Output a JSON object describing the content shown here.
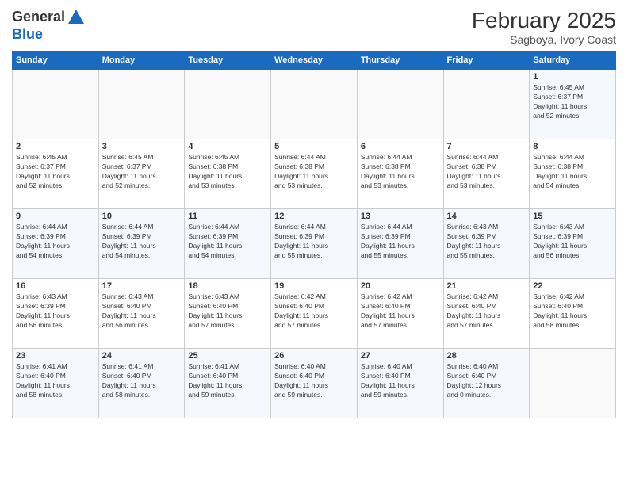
{
  "logo": {
    "general": "General",
    "blue": "Blue"
  },
  "header": {
    "month": "February 2025",
    "location": "Sagboya, Ivory Coast"
  },
  "days_of_week": [
    "Sunday",
    "Monday",
    "Tuesday",
    "Wednesday",
    "Thursday",
    "Friday",
    "Saturday"
  ],
  "weeks": [
    {
      "days": [
        {
          "num": "",
          "info": ""
        },
        {
          "num": "",
          "info": ""
        },
        {
          "num": "",
          "info": ""
        },
        {
          "num": "",
          "info": ""
        },
        {
          "num": "",
          "info": ""
        },
        {
          "num": "",
          "info": ""
        },
        {
          "num": "1",
          "info": "Sunrise: 6:45 AM\nSunset: 6:37 PM\nDaylight: 11 hours\nand 52 minutes."
        }
      ]
    },
    {
      "days": [
        {
          "num": "2",
          "info": "Sunrise: 6:45 AM\nSunset: 6:37 PM\nDaylight: 11 hours\nand 52 minutes."
        },
        {
          "num": "3",
          "info": "Sunrise: 6:45 AM\nSunset: 6:37 PM\nDaylight: 11 hours\nand 52 minutes."
        },
        {
          "num": "4",
          "info": "Sunrise: 6:45 AM\nSunset: 6:38 PM\nDaylight: 11 hours\nand 53 minutes."
        },
        {
          "num": "5",
          "info": "Sunrise: 6:44 AM\nSunset: 6:38 PM\nDaylight: 11 hours\nand 53 minutes."
        },
        {
          "num": "6",
          "info": "Sunrise: 6:44 AM\nSunset: 6:38 PM\nDaylight: 11 hours\nand 53 minutes."
        },
        {
          "num": "7",
          "info": "Sunrise: 6:44 AM\nSunset: 6:38 PM\nDaylight: 11 hours\nand 53 minutes."
        },
        {
          "num": "8",
          "info": "Sunrise: 6:44 AM\nSunset: 6:38 PM\nDaylight: 11 hours\nand 54 minutes."
        }
      ]
    },
    {
      "days": [
        {
          "num": "9",
          "info": "Sunrise: 6:44 AM\nSunset: 6:39 PM\nDaylight: 11 hours\nand 54 minutes."
        },
        {
          "num": "10",
          "info": "Sunrise: 6:44 AM\nSunset: 6:39 PM\nDaylight: 11 hours\nand 54 minutes."
        },
        {
          "num": "11",
          "info": "Sunrise: 6:44 AM\nSunset: 6:39 PM\nDaylight: 11 hours\nand 54 minutes."
        },
        {
          "num": "12",
          "info": "Sunrise: 6:44 AM\nSunset: 6:39 PM\nDaylight: 11 hours\nand 55 minutes."
        },
        {
          "num": "13",
          "info": "Sunrise: 6:44 AM\nSunset: 6:39 PM\nDaylight: 11 hours\nand 55 minutes."
        },
        {
          "num": "14",
          "info": "Sunrise: 6:43 AM\nSunset: 6:39 PM\nDaylight: 11 hours\nand 55 minutes."
        },
        {
          "num": "15",
          "info": "Sunrise: 6:43 AM\nSunset: 6:39 PM\nDaylight: 11 hours\nand 56 minutes."
        }
      ]
    },
    {
      "days": [
        {
          "num": "16",
          "info": "Sunrise: 6:43 AM\nSunset: 6:39 PM\nDaylight: 11 hours\nand 56 minutes."
        },
        {
          "num": "17",
          "info": "Sunrise: 6:43 AM\nSunset: 6:40 PM\nDaylight: 11 hours\nand 56 minutes."
        },
        {
          "num": "18",
          "info": "Sunrise: 6:43 AM\nSunset: 6:40 PM\nDaylight: 11 hours\nand 57 minutes."
        },
        {
          "num": "19",
          "info": "Sunrise: 6:42 AM\nSunset: 6:40 PM\nDaylight: 11 hours\nand 57 minutes."
        },
        {
          "num": "20",
          "info": "Sunrise: 6:42 AM\nSunset: 6:40 PM\nDaylight: 11 hours\nand 57 minutes."
        },
        {
          "num": "21",
          "info": "Sunrise: 6:42 AM\nSunset: 6:40 PM\nDaylight: 11 hours\nand 57 minutes."
        },
        {
          "num": "22",
          "info": "Sunrise: 6:42 AM\nSunset: 6:40 PM\nDaylight: 11 hours\nand 58 minutes."
        }
      ]
    },
    {
      "days": [
        {
          "num": "23",
          "info": "Sunrise: 6:41 AM\nSunset: 6:40 PM\nDaylight: 11 hours\nand 58 minutes."
        },
        {
          "num": "24",
          "info": "Sunrise: 6:41 AM\nSunset: 6:40 PM\nDaylight: 11 hours\nand 58 minutes."
        },
        {
          "num": "25",
          "info": "Sunrise: 6:41 AM\nSunset: 6:40 PM\nDaylight: 11 hours\nand 59 minutes."
        },
        {
          "num": "26",
          "info": "Sunrise: 6:40 AM\nSunset: 6:40 PM\nDaylight: 11 hours\nand 59 minutes."
        },
        {
          "num": "27",
          "info": "Sunrise: 6:40 AM\nSunset: 6:40 PM\nDaylight: 11 hours\nand 59 minutes."
        },
        {
          "num": "28",
          "info": "Sunrise: 6:40 AM\nSunset: 6:40 PM\nDaylight: 12 hours\nand 0 minutes."
        },
        {
          "num": "",
          "info": ""
        }
      ]
    }
  ]
}
